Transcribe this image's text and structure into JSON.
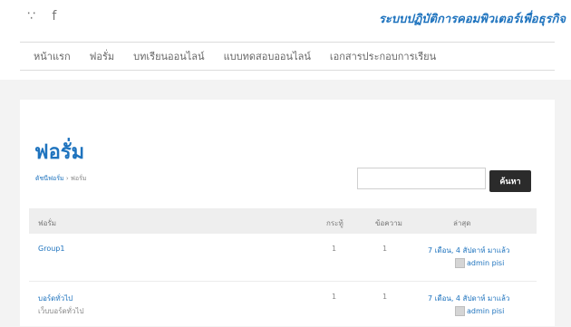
{
  "header": {
    "site_title": "ระบบปฏิบัติการคอมพิวเตอร์เพื่อธุรกิจ",
    "social_icons": [
      "rss-icon",
      "facebook-icon"
    ]
  },
  "nav": {
    "items": [
      "หน้าแรก",
      "ฟอรั่ม",
      "บทเรียนออนไลน์",
      "แบบทดสอบออนไลน์",
      "เอกสารประกอบการเรียน"
    ]
  },
  "page": {
    "title": "ฟอรั่ม",
    "breadcrumb": {
      "parent": "ดัชนีฟอรั่ม",
      "separator": "›",
      "current": "ฟอรั่ม"
    }
  },
  "search": {
    "value": "",
    "button_label": "ค้นหา"
  },
  "table": {
    "headers": [
      "ฟอรั่ม",
      "กระทู้",
      "ข้อความ",
      "ล่าสุด"
    ],
    "rows": [
      {
        "forum": "Group1",
        "description": "",
        "topics": "1",
        "posts": "1",
        "last_time": "7 เดือน, 4 สัปดาห์ มาแล้ว",
        "last_user": "admin pisi"
      },
      {
        "forum": "บอร์ดทั่วไป",
        "description": "เว็บบอร์ดทั่วไป",
        "topics": "1",
        "posts": "1",
        "last_time": "7 เดือน, 4 สัปดาห์ มาแล้ว",
        "last_user": "admin pisi"
      }
    ]
  },
  "colors": {
    "accent": "#1e73be",
    "button": "#2b2b2b",
    "background": "#f3f3f3"
  }
}
